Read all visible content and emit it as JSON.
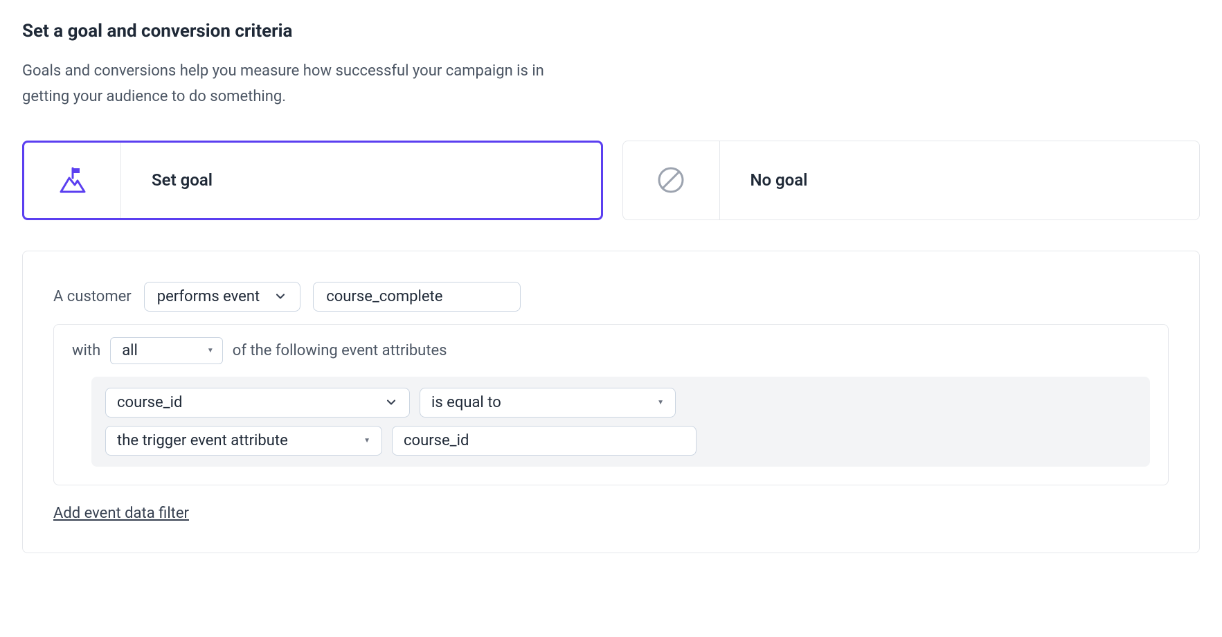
{
  "header": {
    "title": "Set a goal and conversion criteria",
    "description": "Goals and conversions help you measure how successful your campaign is in getting your audience to do something."
  },
  "goal_cards": {
    "set_goal_label": "Set goal",
    "no_goal_label": "No goal"
  },
  "criteria": {
    "leading_text": "A customer",
    "action_select": "performs event",
    "event_input": "course_complete",
    "with_label": "with",
    "with_mode": "all",
    "with_trailing": "of the following event attributes",
    "attr": {
      "field": "course_id",
      "operator": "is equal to",
      "source": "the trigger event attribute",
      "value": "course_id"
    },
    "add_filter_label": "Add event data filter"
  }
}
